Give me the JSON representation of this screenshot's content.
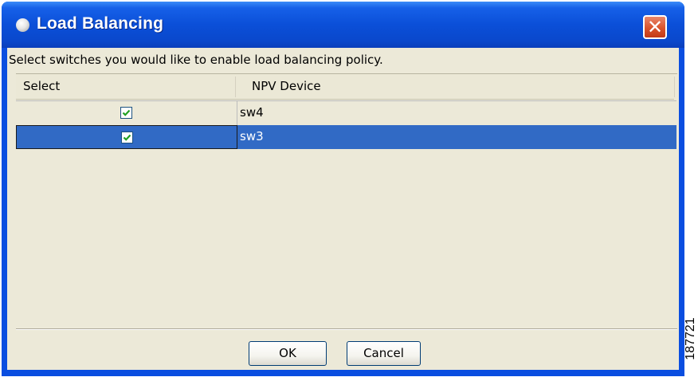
{
  "window": {
    "title": "Load Balancing",
    "close_symbol": "✕",
    "title_icon": "app-icon",
    "colors": {
      "titlebar": "#0a4ee0",
      "client": "#ece9d8",
      "selection": "#316ac5",
      "close": "#d9532c"
    }
  },
  "instruction": "Select switches you would like to enable load balancing policy.",
  "table": {
    "columns": [
      "Select",
      "NPV Device"
    ],
    "rows": [
      {
        "selected": true,
        "device": "sw4",
        "row_selected": false
      },
      {
        "selected": true,
        "device": "sw3",
        "row_selected": true
      }
    ]
  },
  "buttons": {
    "ok": "OK",
    "cancel": "Cancel"
  },
  "figure_id": "187721"
}
